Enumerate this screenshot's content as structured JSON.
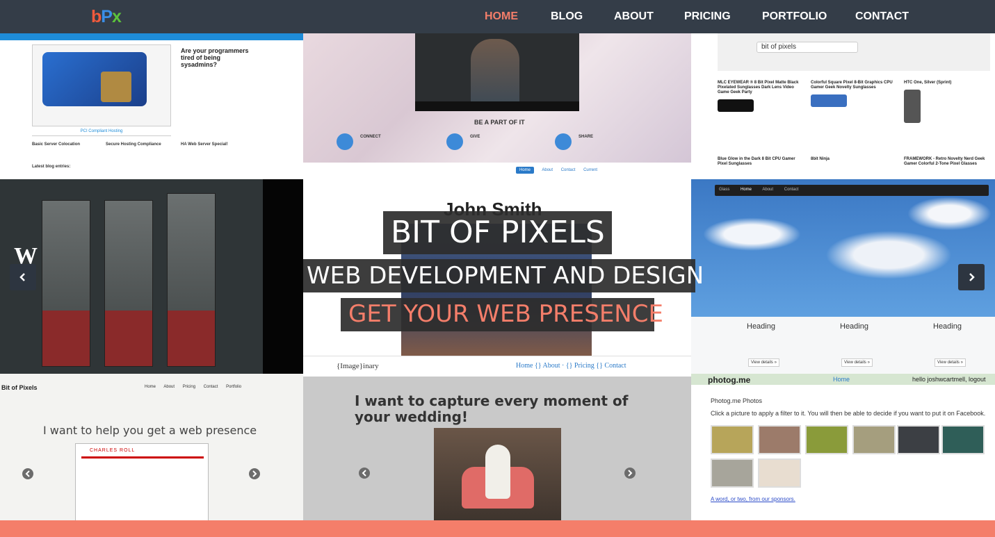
{
  "nav": {
    "logo": {
      "b": "b",
      "p": "P",
      "x": "x"
    },
    "items": [
      {
        "label": "HOME",
        "active": true
      },
      {
        "label": "BLOG",
        "active": false
      },
      {
        "label": "ABOUT",
        "active": false
      },
      {
        "label": "PRICING",
        "active": false
      },
      {
        "label": "PORTFOLIO",
        "active": false
      },
      {
        "label": "CONTACT",
        "active": false
      }
    ]
  },
  "hero": {
    "title": "BIT OF PIXELS",
    "subtitle": "WEB DEVELOPMENT AND DESIGN",
    "cta": "GET YOUR WEB PRESENCE"
  },
  "tiles": {
    "hosting": {
      "headline": "Are your programmers tired of being sysadmins?",
      "caption": "PCI Compliant Hosting",
      "cols": [
        "Basic Server Colocation",
        "Secure Hosting Compliance",
        "HA Web Server Special!"
      ],
      "blog": "Latest blog entries:"
    },
    "crowdfund": {
      "join": "BE A PART OF IT",
      "cols": [
        "CONNECT",
        "GIVE",
        "SHARE"
      ]
    },
    "amazon": {
      "search_value": "bit of pixels",
      "products": [
        "MLC EYEWEAR ® 8 Bit Pixel Matte Black Pixelated Sunglasses Dark Lens Video Game Geek Party",
        "Colorful Square Pixel 8-Bit Graphics CPU Gamer Geek Novelty Sunglasses",
        "HTC One, Silver (Sprint)",
        "Blue Glow in the Dark 8 Bit CPU Gamer Pixel Sunglasses",
        "8bit Ninja",
        "FRAMEWORK - Retro Novelty Nerd Geek Gamer Colorful 2-Tone Pixel Glasses"
      ]
    },
    "portfolio_person": {
      "nav": [
        "Home",
        "About",
        "Contact",
        "Current"
      ],
      "name": "John Smith",
      "footer_logo": "{Image}inary",
      "footer_nav": "Home {} About · {} Pricing {} Contact"
    },
    "sky": {
      "nav": [
        "Glass",
        "Home",
        "About",
        "Contact"
      ],
      "headings": [
        "Heading",
        "Heading",
        "Heading"
      ],
      "button": "View details »"
    },
    "bitofpixels_site": {
      "brand": "Bit of Pixels",
      "links": [
        "Home",
        "About",
        "Pricing",
        "Contact",
        "Portfolio"
      ],
      "tagline": "I want to help you get a web presence",
      "shot_title": "CHARLES ROLL"
    },
    "wedding": {
      "headline": "I want to capture every moment of your wedding!"
    },
    "photog": {
      "site": "photog.me",
      "home": "Home",
      "hello": "hello joshwcartmell, logout",
      "title": "Photog.me Photos",
      "sub": "Click a picture to apply a filter to it. You will then be able to decide if you want to put it on Facebook.",
      "sponsor": "A word, or two, from our sponsors."
    }
  },
  "colors": {
    "navbar": "#343d48",
    "accent": "#f47e6a",
    "overlay": "#2c2c2c",
    "logo_b": "#f05a3c",
    "logo_p": "#3a8ee6",
    "logo_x": "#5cc23b"
  },
  "icons": {
    "prev": "chevron-left-icon",
    "next": "chevron-right-icon"
  }
}
